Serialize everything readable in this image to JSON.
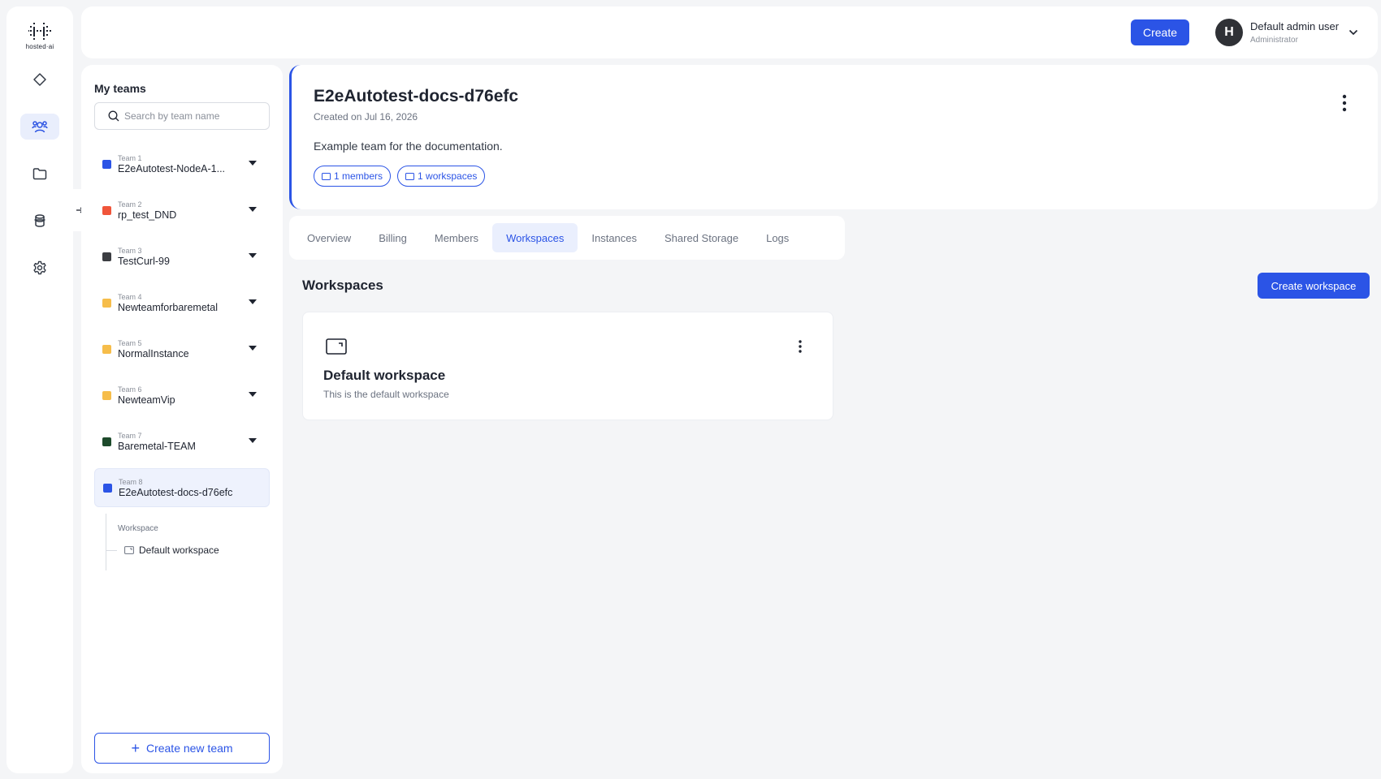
{
  "app": {
    "logo_text": "hosted·ai"
  },
  "topbar": {
    "create_label": "Create",
    "user": {
      "initial": "H",
      "name": "Default admin user",
      "role": "Administrator"
    }
  },
  "teams_panel": {
    "title": "My teams",
    "search_placeholder": "Search by team name",
    "teams": [
      {
        "number": "Team 1",
        "name": "E2eAutotest-NodeA-1...",
        "color": "#2b54e6"
      },
      {
        "number": "Team 2",
        "name": "rp_test_DND",
        "color": "#f0553a"
      },
      {
        "number": "Team 3",
        "name": "TestCurl-99",
        "color": "#3b3d42"
      },
      {
        "number": "Team 4",
        "name": "Newteamforbaremetal",
        "color": "#f6bd4a"
      },
      {
        "number": "Team 5",
        "name": "NormalInstance",
        "color": "#f6bd4a"
      },
      {
        "number": "Team 6",
        "name": "NewteamVip",
        "color": "#f6bd4a"
      },
      {
        "number": "Team 7",
        "name": "Baremetal-TEAM",
        "color": "#1d4a2b"
      },
      {
        "number": "Team 8",
        "name": "E2eAutotest-docs-d76efc",
        "color": "#2b54e6"
      }
    ],
    "workspace_label": "Workspace",
    "workspace_item": "Default workspace",
    "create_team_label": "Create new team"
  },
  "team_card": {
    "title": "E2eAutotest-docs-d76efc",
    "created": "Created on Jul 16, 2026",
    "description": "Example team for the documentation.",
    "members_chip": "1 members",
    "workspaces_chip": "1 workspaces"
  },
  "tabs": [
    "Overview",
    "Billing",
    "Members",
    "Workspaces",
    "Instances",
    "Shared Storage",
    "Logs"
  ],
  "active_tab": "Workspaces",
  "workspaces_section": {
    "title": "Workspaces",
    "create_label": "Create workspace",
    "card": {
      "title": "Default workspace",
      "description": "This is the default workspace"
    }
  },
  "colors": {
    "accent": "#2b54e6",
    "background": "#f4f5f7"
  }
}
